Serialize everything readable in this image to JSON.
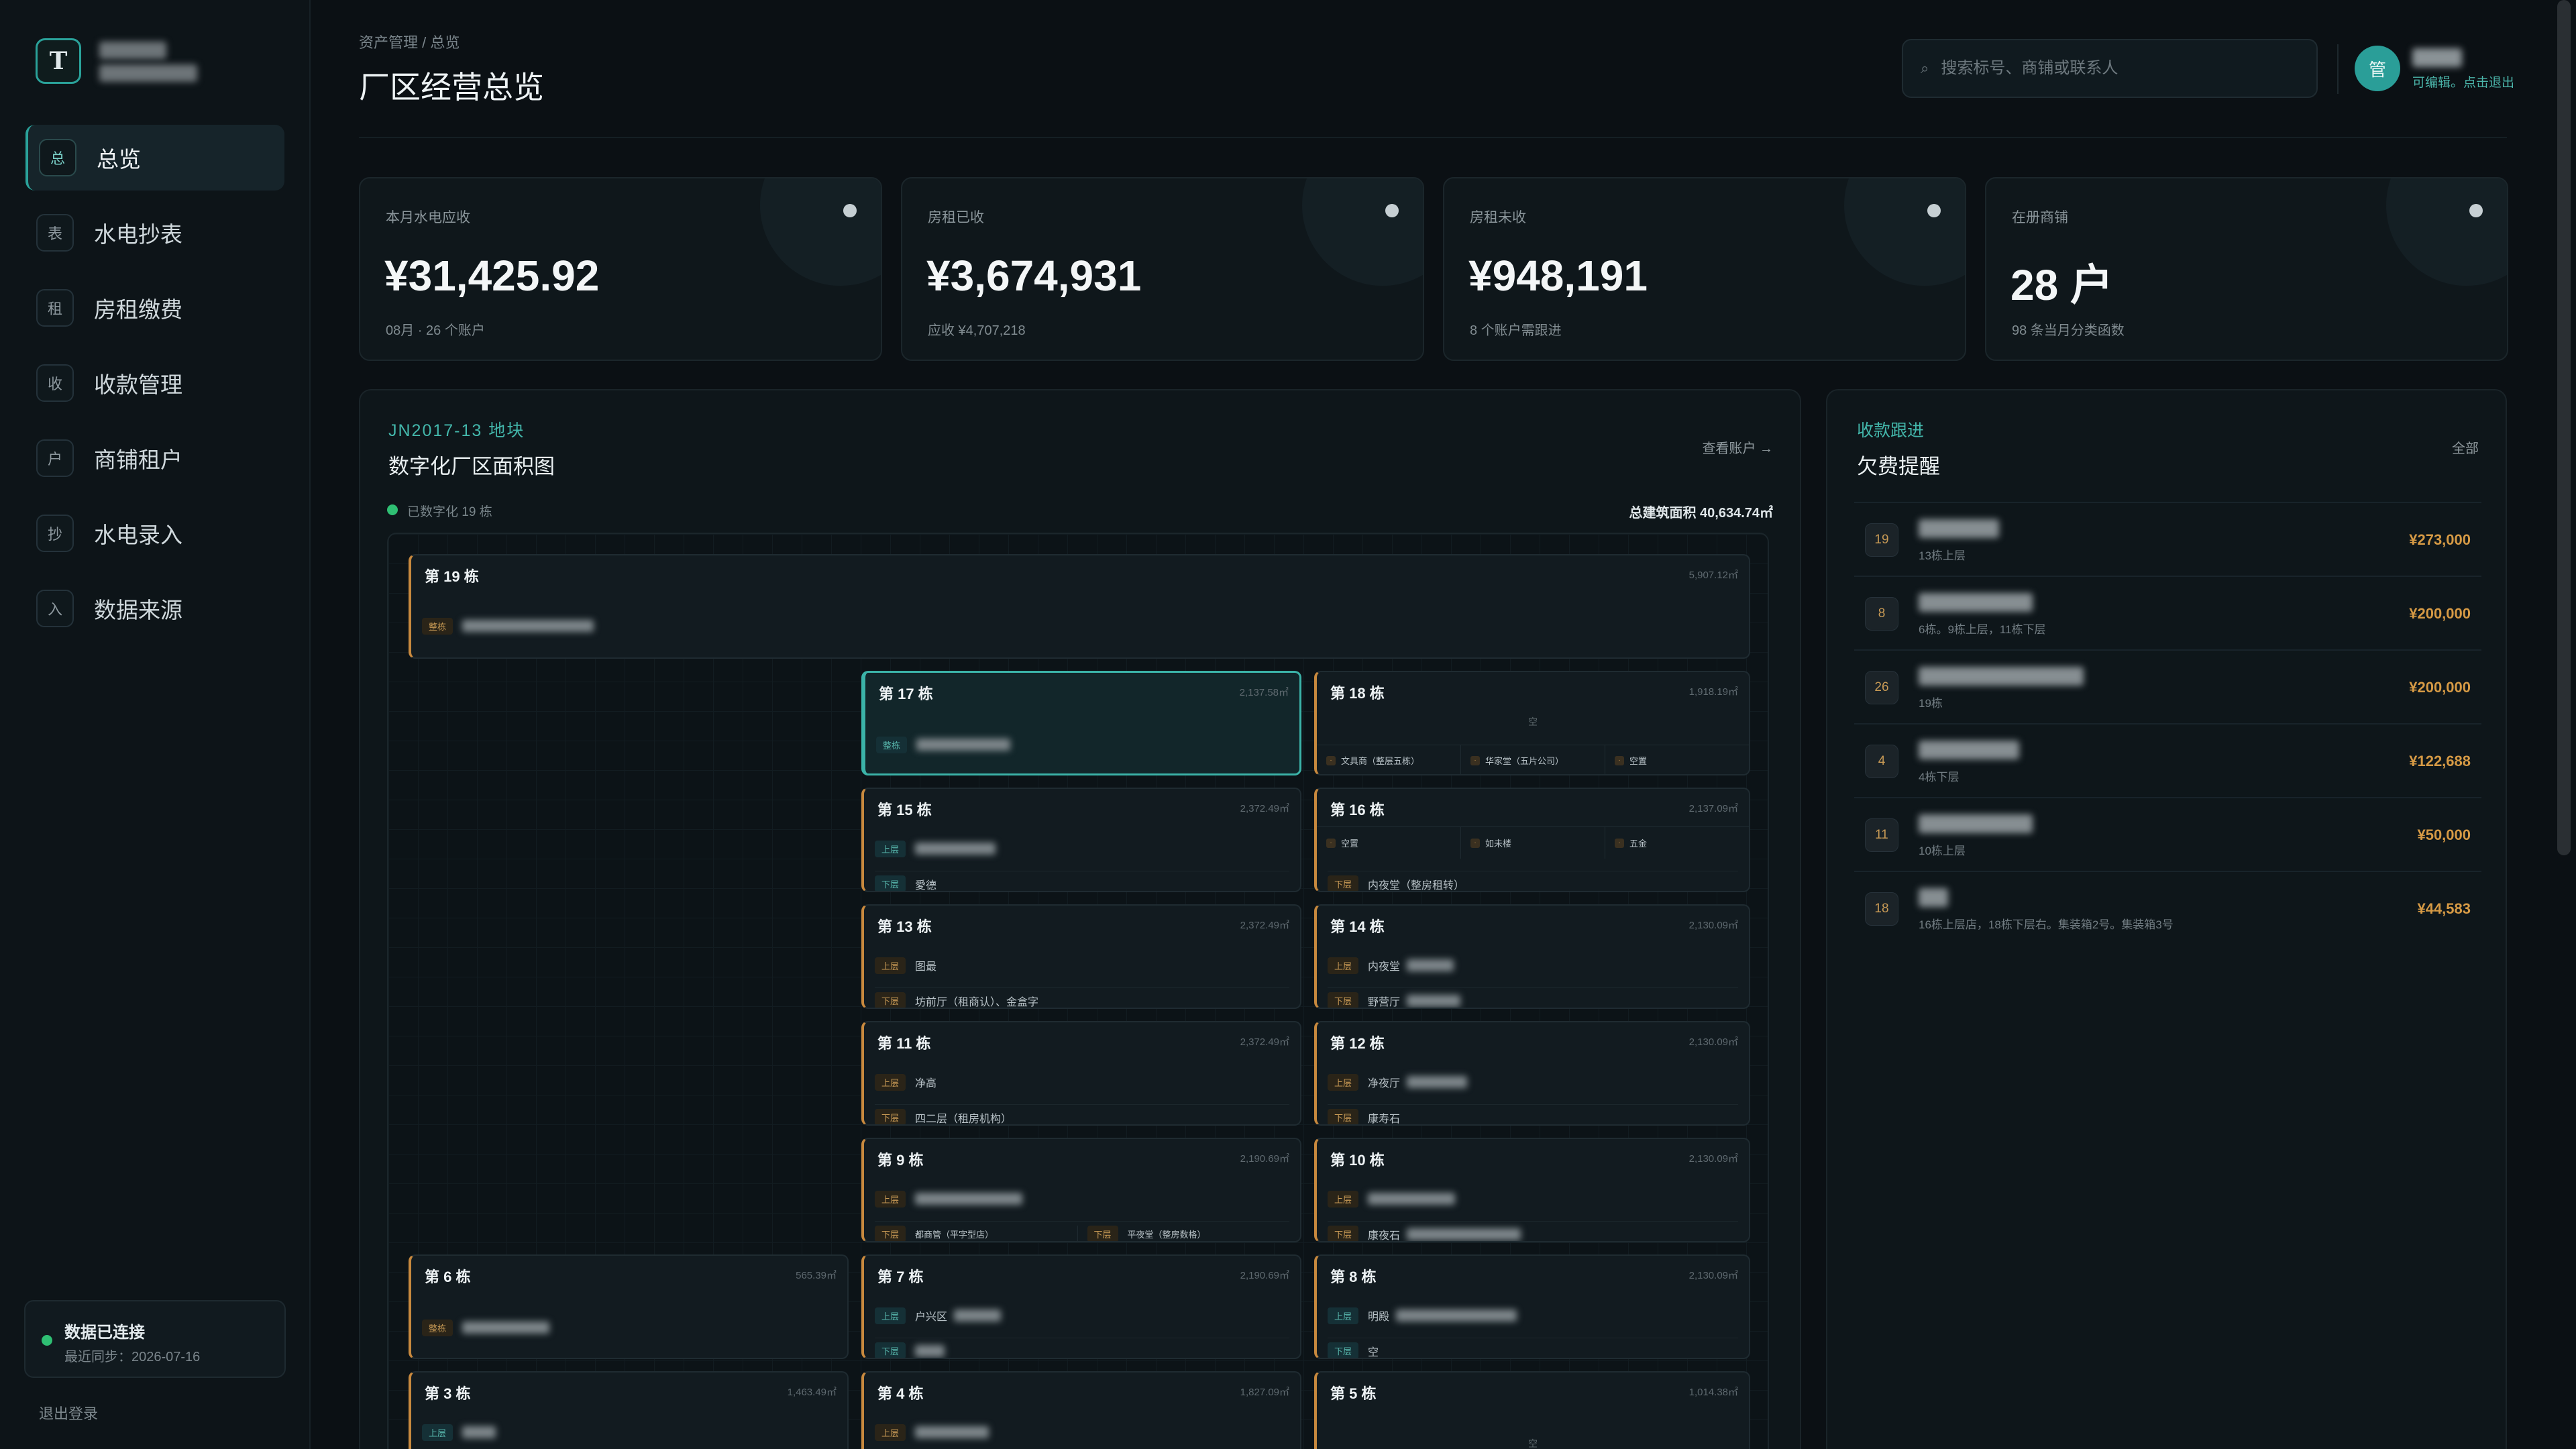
{
  "sidebar": {
    "logo_letter": "T",
    "items": [
      {
        "label": "总览",
        "icon": "总"
      },
      {
        "label": "水电抄表",
        "icon": "表"
      },
      {
        "label": "房租缴费",
        "icon": "租"
      },
      {
        "label": "收款管理",
        "icon": "收"
      },
      {
        "label": "商铺租户",
        "icon": "户"
      },
      {
        "label": "水电录入",
        "icon": "抄"
      },
      {
        "label": "数据来源",
        "icon": "入"
      }
    ],
    "status": {
      "title": "数据已连接",
      "sub": "最近同步：2026-07-16"
    },
    "logout": "退出登录"
  },
  "header": {
    "breadcrumb": "资产管理 / 总览",
    "title": "厂区经营总览",
    "search_placeholder": "搜索标号、商铺或联系人",
    "avatar": "管",
    "user_hint": "可编辑。点击退出"
  },
  "kpis": [
    {
      "label": "本月水电应收",
      "value": "¥31,425.92",
      "sub": "08月 · 26 个账户"
    },
    {
      "label": "房租已收",
      "value": "¥3,674,931",
      "sub": "应收 ¥4,707,218"
    },
    {
      "label": "房租未收",
      "value": "¥948,191",
      "sub": "8 个账户需跟进"
    },
    {
      "label": "在册商铺",
      "value": "28 户",
      "sub": "98 条当月分类函数"
    }
  ],
  "map": {
    "plot_code": "JN2017-13 地块",
    "title": "数字化厂区面积图",
    "view_accounts": "查看账户 →",
    "legend": "已数字化 19 栋",
    "total_area": "总建筑面积 40,634.74㎡",
    "buildings": [
      {
        "name": "第 19 栋",
        "area": "5,907.12㎡"
      },
      {
        "name": "第 17 栋",
        "area": "2,137.58㎡"
      },
      {
        "name": "第 18 栋",
        "area": "1,918.19㎡"
      },
      {
        "name": "第 15 栋",
        "area": "2,372.49㎡"
      },
      {
        "name": "第 16 栋",
        "area": "2,137.09㎡"
      },
      {
        "name": "第 13 栋",
        "area": "2,372.49㎡"
      },
      {
        "name": "第 14 栋",
        "area": "2,130.09㎡"
      },
      {
        "name": "第 11 栋",
        "area": "2,372.49㎡"
      },
      {
        "name": "第 12 栋",
        "area": "2,130.09㎡"
      },
      {
        "name": "第 9 栋",
        "area": "2,190.69㎡"
      },
      {
        "name": "第 10 栋",
        "area": "2,130.09㎡"
      },
      {
        "name": "第 6 栋",
        "area": "565.39㎡"
      },
      {
        "name": "第 7 栋",
        "area": "2,190.69㎡"
      },
      {
        "name": "第 8 栋",
        "area": "2,130.09㎡"
      },
      {
        "name": "第 3 栋",
        "area": "1,463.49㎡"
      },
      {
        "name": "第 4 栋",
        "area": "1,827.09㎡"
      },
      {
        "name": "第 5 栋",
        "area": "1,014.38㎡"
      }
    ],
    "tags": {
      "whole": "整栋",
      "upper": "上层",
      "lower": "下层"
    },
    "texts": {
      "empty": "空",
      "b18_c1": "文具商（整层五栋）",
      "b18_c2": "华家堂（五片公司）",
      "b18_c3": "空置",
      "b16_c1": "空置",
      "b16_c2": "如未楼",
      "b16_c3": "五金",
      "b16_lower": "内夜堂（整房租转）",
      "b15_lower": "愛德",
      "b13_upper": "图最",
      "b13_lower": "坊前厅（租商认）、金盒字",
      "b14_upper": "内夜堂",
      "b14_lower": "野营厅",
      "b11_upper": "净高",
      "b11_lower": "四二层（租房机构）",
      "b12_upper": "净夜厅",
      "b12_lower": "康寿石",
      "b9_lower_a": "都商管（平字型店）",
      "b9_lower_b": "平夜堂（整房数格）",
      "b10_lower": "康夜石",
      "b7_upper": "户兴区",
      "b8_upper": "明殿",
      "b8_lower": "空"
    }
  },
  "arrears": {
    "kicker": "收款跟进",
    "title": "欠费提醒",
    "all": "全部",
    "items": [
      {
        "no": "19",
        "desc": "13栋上层",
        "amount": "¥273,000"
      },
      {
        "no": "8",
        "desc": "6栋。9栋上层，11栋下层",
        "amount": "¥200,000"
      },
      {
        "no": "26",
        "desc": "19栋",
        "amount": "¥200,000"
      },
      {
        "no": "4",
        "desc": "4栋下层",
        "amount": "¥122,688"
      },
      {
        "no": "11",
        "desc": "10栋上层",
        "amount": "¥50,000"
      },
      {
        "no": "18",
        "desc": "16栋上层店，18栋下层右。集装箱2号。集装箱3号",
        "amount": "¥44,583"
      }
    ]
  }
}
